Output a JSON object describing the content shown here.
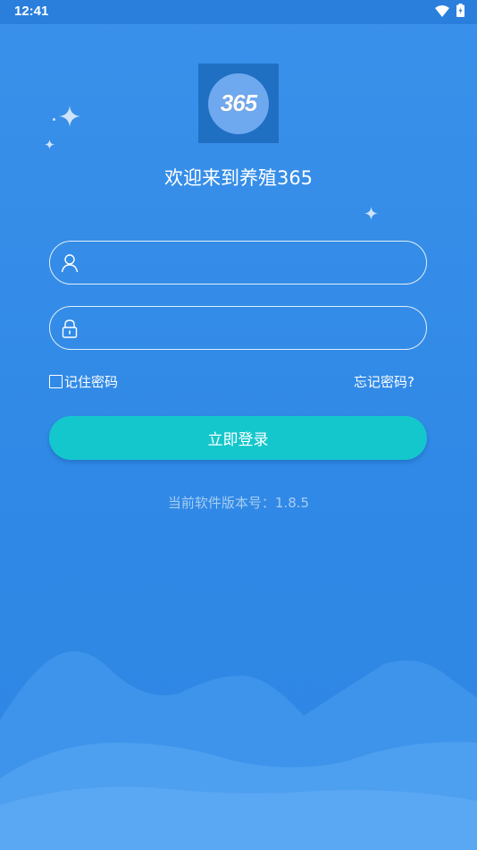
{
  "status_bar": {
    "time": "12:41",
    "icons": [
      "wifi-icon",
      "battery-icon"
    ]
  },
  "logo": {
    "text": "365",
    "icon": "app-logo-icon"
  },
  "welcome_text": "欢迎来到养殖365",
  "form": {
    "username": {
      "value": "",
      "placeholder": "",
      "icon": "user-icon"
    },
    "password": {
      "value": "",
      "placeholder": "",
      "icon": "lock-icon"
    },
    "remember_label": "记住密码",
    "remember_checked": false,
    "forgot_label": "忘记密码?",
    "login_label": "立即登录"
  },
  "version_text": "当前软件版本号：1.8.5",
  "colors": {
    "background": "#3089e6",
    "status_bar": "#2a7fdc",
    "login_button": "#14c7cc",
    "version_text": "#a7cdf3"
  }
}
